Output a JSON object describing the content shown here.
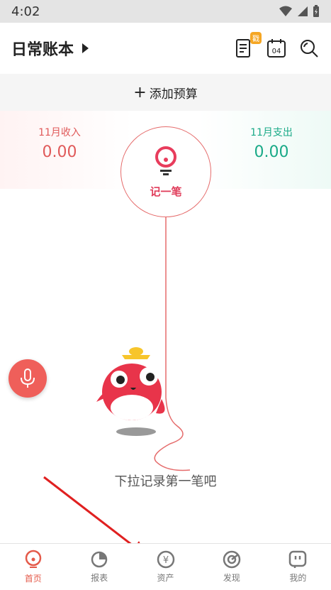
{
  "status_bar": {
    "time": "4:02"
  },
  "header": {
    "book_name": "日常账本",
    "badge": "戳",
    "calendar_day": "04"
  },
  "budget": {
    "add_label": "添加预算"
  },
  "summary": {
    "income_label": "11月收入",
    "income_value": "0.00",
    "expense_label": "11月支出",
    "expense_value": "0.00"
  },
  "record": {
    "label": "记一笔"
  },
  "empty_hint": "下拉记录第一笔吧",
  "nav": {
    "items": [
      {
        "label": "首页",
        "icon": "home-icon"
      },
      {
        "label": "报表",
        "icon": "report-icon"
      },
      {
        "label": "资产",
        "icon": "assets-icon"
      },
      {
        "label": "发现",
        "icon": "discover-icon"
      },
      {
        "label": "我的",
        "icon": "profile-icon"
      }
    ]
  },
  "colors": {
    "accent": "#e45a4a",
    "income": "#e05a5a",
    "expense": "#1aaa88"
  }
}
